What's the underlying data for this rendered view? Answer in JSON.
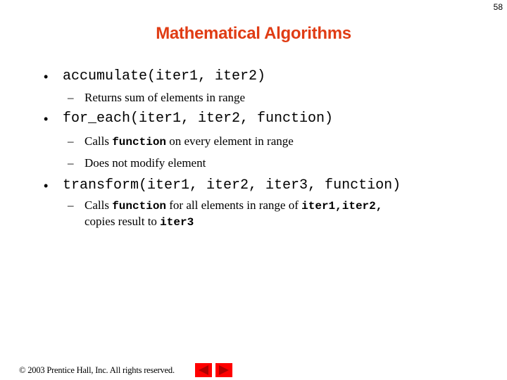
{
  "page_number": "58",
  "title": "Mathematical Algorithms",
  "bullets": [
    {
      "bullet_glyph": "•",
      "text": "accumulate(iter1, iter2)",
      "subitems": [
        {
          "dash": "–",
          "parts": [
            {
              "t": "Returns sum of elements in range",
              "mono": false
            }
          ]
        }
      ]
    },
    {
      "bullet_glyph": "•",
      "text": "for_each(iter1, iter2, function)",
      "subitems": [
        {
          "dash": "–",
          "parts": [
            {
              "t": "Calls ",
              "mono": false
            },
            {
              "t": "function",
              "mono": true
            },
            {
              "t": " on every element in range",
              "mono": false
            }
          ]
        },
        {
          "dash": "–",
          "parts": [
            {
              "t": "Does not modify element",
              "mono": false
            }
          ]
        }
      ]
    },
    {
      "bullet_glyph": "•",
      "text": "transform(iter1, iter2, iter3, function)",
      "subitems": [
        {
          "dash": "–",
          "parts": [
            {
              "t": "Calls ",
              "mono": false
            },
            {
              "t": "function",
              "mono": true
            },
            {
              "t": " for all elements in range of ",
              "mono": false
            },
            {
              "t": "iter1,iter2,",
              "mono": true
            },
            {
              "t": "\ncopies result to ",
              "mono": false
            },
            {
              "t": "iter3",
              "mono": true
            }
          ]
        }
      ]
    }
  ],
  "footer": {
    "copyright": "© 2003 Prentice Hall, Inc.  All rights reserved."
  },
  "nav": {
    "prev_icon": "triangle-left-icon",
    "next_icon": "triangle-right-icon",
    "button_color": "#ff0000",
    "arrow_color": "#b00000"
  },
  "colors": {
    "title": "#e03c14"
  }
}
